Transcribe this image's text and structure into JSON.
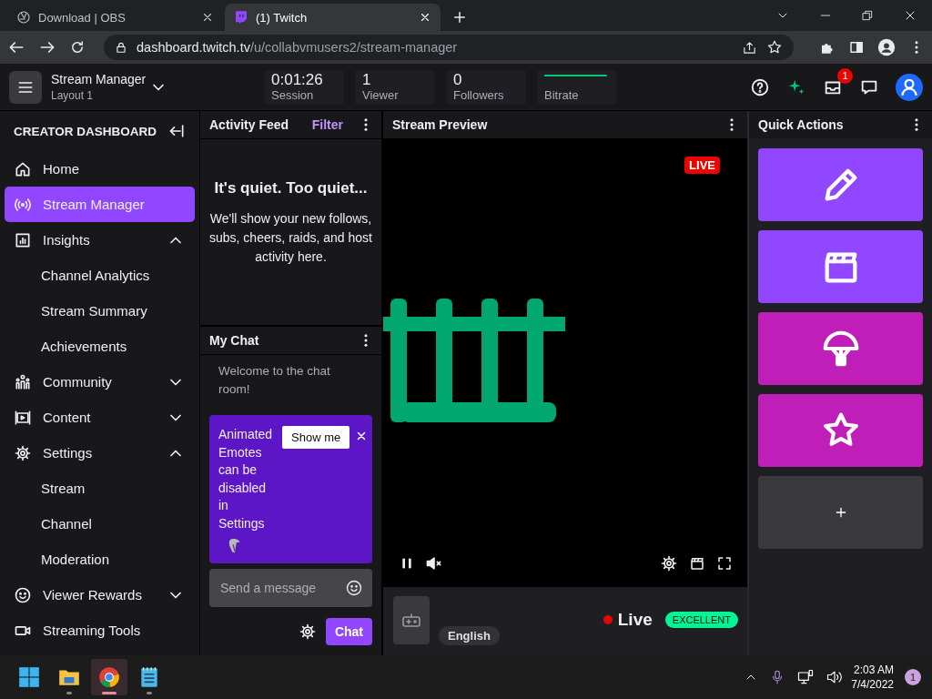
{
  "browser": {
    "tabs": [
      {
        "title": "Download | OBS",
        "selected": false
      },
      {
        "title": "(1) Twitch",
        "selected": true
      }
    ],
    "url": {
      "host": "dashboard.twitch.tv",
      "path": "/u/collabvmusers2/stream-manager"
    }
  },
  "header": {
    "title": "Stream Manager",
    "subtitle": "Layout 1",
    "inbox_badge": "1",
    "stats": [
      {
        "kind": "value",
        "value": "0:01:26",
        "label": "Session"
      },
      {
        "kind": "value",
        "value": "1",
        "label": "Viewer"
      },
      {
        "kind": "value",
        "value": "0",
        "label": "Followers"
      },
      {
        "kind": "sparkline",
        "label": "Bitrate"
      }
    ]
  },
  "sidebar": {
    "title": "CREATOR DASHBOARD",
    "items": [
      {
        "label": "Home",
        "selected": false
      },
      {
        "label": "Stream Manager",
        "selected": true
      },
      {
        "label": "Insights",
        "selected": false,
        "expanded": true,
        "children": [
          {
            "label": "Channel Analytics",
            "selected": false
          },
          {
            "label": "Stream Summary",
            "selected": false
          },
          {
            "label": "Achievements",
            "selected": false
          }
        ]
      },
      {
        "label": "Community",
        "selected": false,
        "expanded": false
      },
      {
        "label": "Content",
        "selected": false,
        "expanded": false
      },
      {
        "label": "Settings",
        "selected": false,
        "expanded": true,
        "children": [
          {
            "label": "Stream",
            "selected": false
          },
          {
            "label": "Channel",
            "selected": false
          },
          {
            "label": "Moderation",
            "selected": false
          }
        ]
      },
      {
        "label": "Viewer Rewards",
        "selected": false,
        "expanded": false
      },
      {
        "label": "Streaming Tools",
        "selected": false
      }
    ]
  },
  "activity_feed": {
    "title": "Activity Feed",
    "filter": "Filter",
    "heading": "It's quiet. Too quiet...",
    "message": "We'll show your new follows, subs, cheers, raids, and host activity here."
  },
  "chat": {
    "title": "My Chat",
    "welcome": "Welcome to the chat room!",
    "notice": {
      "text": "Animated Emotes can be disabled in Settings",
      "button": "Show me"
    },
    "placeholder": "Send a message",
    "send": "Chat"
  },
  "preview": {
    "title": "Stream Preview",
    "live_badge": "LIVE",
    "muted": true,
    "language": "English",
    "status": "Live",
    "quality": "EXCELLENT"
  },
  "quick_actions": {
    "title": "Quick Actions",
    "actions": [
      {
        "color": "#9147ff"
      },
      {
        "color": "#9147ff"
      },
      {
        "color": "#bf1fb8"
      },
      {
        "color": "#bf1fb8"
      }
    ]
  },
  "taskbar": {
    "apps": [
      {
        "selected": false
      },
      {
        "selected": false
      },
      {
        "selected": true
      },
      {
        "selected": false
      }
    ],
    "time": "2:03 AM",
    "date": "7/4/2022",
    "notifications": "1"
  }
}
